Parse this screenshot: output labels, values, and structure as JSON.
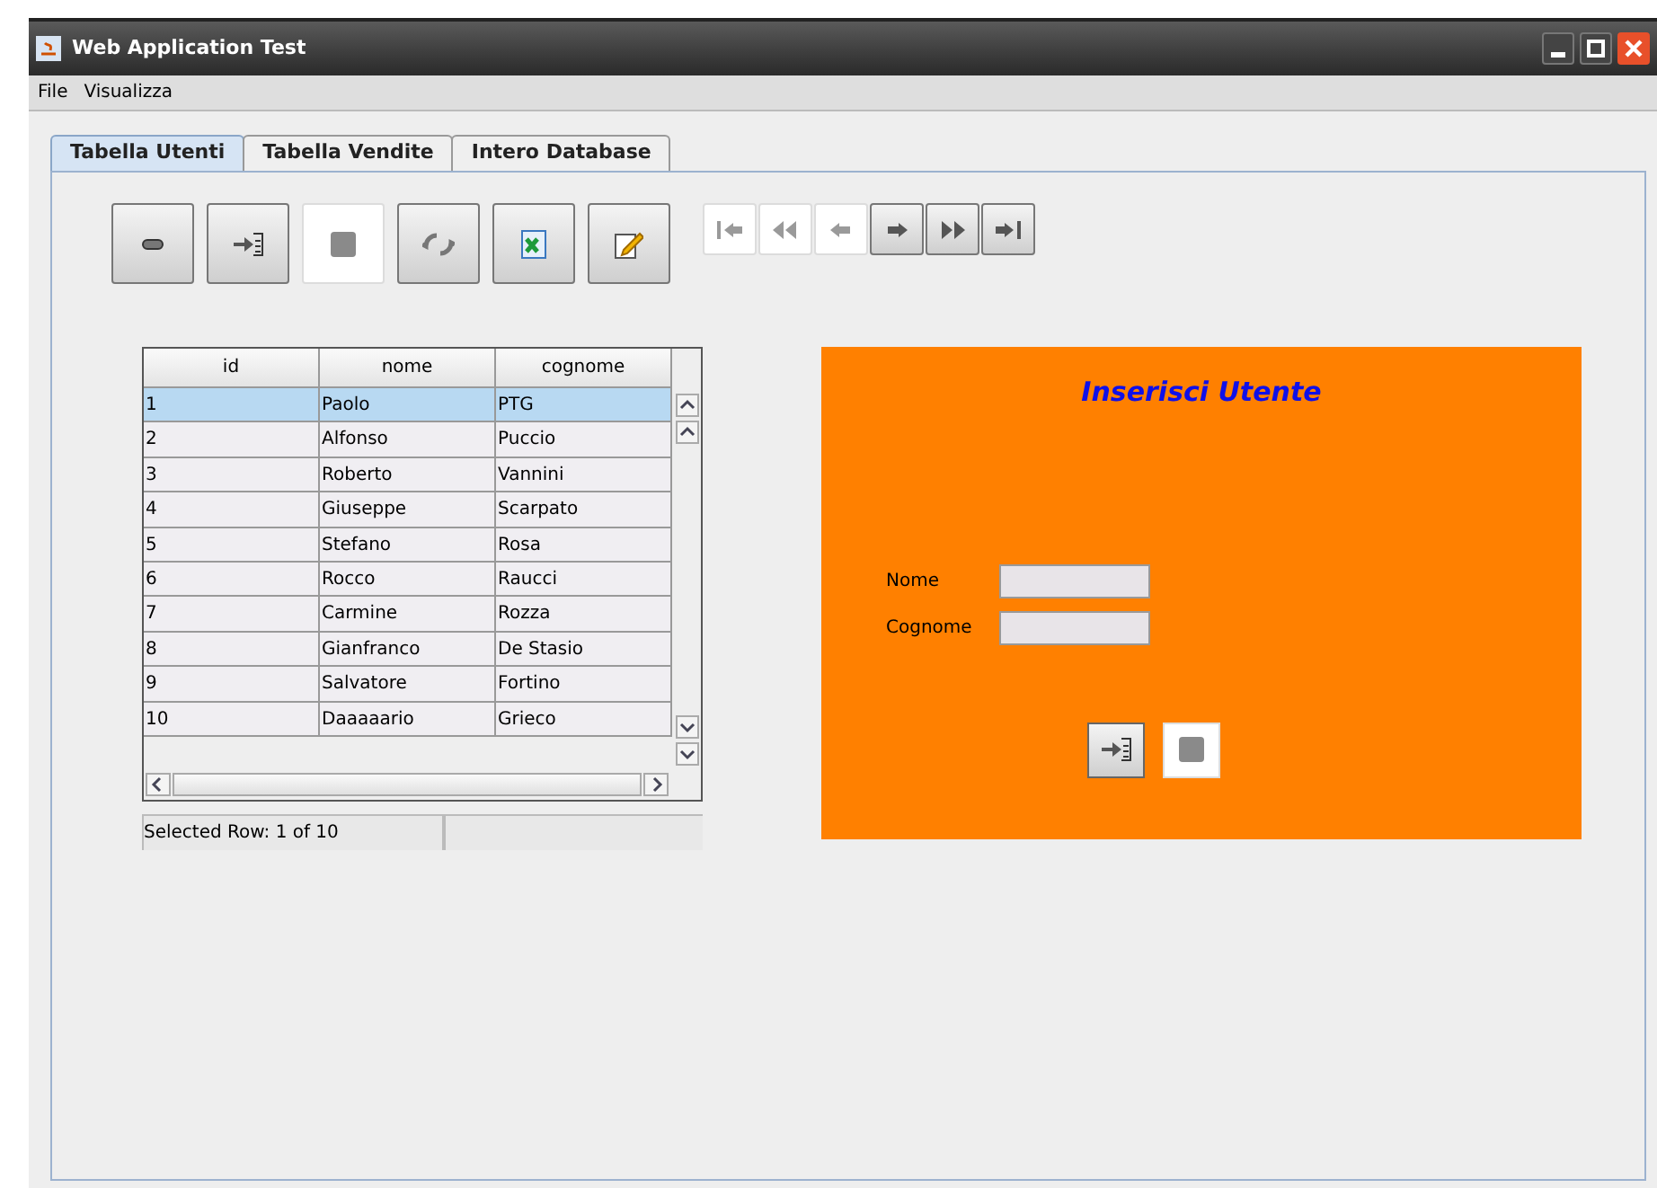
{
  "window": {
    "title": "Web Application Test"
  },
  "menu": [
    "File",
    "Visualizza"
  ],
  "tabs": [
    {
      "label": "Tabella Utenti",
      "selected": true
    },
    {
      "label": "Tabella Vendite",
      "selected": false
    },
    {
      "label": "Intero Database",
      "selected": false
    }
  ],
  "toolbar": [
    {
      "kind": "remove",
      "disabled": false
    },
    {
      "kind": "import",
      "disabled": false
    },
    {
      "kind": "save",
      "disabled": true
    },
    {
      "kind": "refresh",
      "disabled": false
    },
    {
      "kind": "spreadsheet",
      "disabled": false
    },
    {
      "kind": "edit",
      "disabled": false
    }
  ],
  "navigation": [
    {
      "kind": "first",
      "disabled": true
    },
    {
      "kind": "rewind",
      "disabled": true
    },
    {
      "kind": "previous",
      "disabled": true
    },
    {
      "kind": "next",
      "disabled": false
    },
    {
      "kind": "forward",
      "disabled": false
    },
    {
      "kind": "last",
      "disabled": false
    }
  ],
  "table": {
    "columns": [
      "id",
      "nome",
      "cognome"
    ],
    "rows": [
      {
        "cells": [
          "1",
          "Paolo",
          "PTG"
        ],
        "selected": true
      },
      {
        "cells": [
          "2",
          "Alfonso",
          "Puccio"
        ],
        "selected": false
      },
      {
        "cells": [
          "3",
          "Roberto",
          "Vannini"
        ],
        "selected": false
      },
      {
        "cells": [
          "4",
          "Giuseppe",
          "Scarpato"
        ],
        "selected": false
      },
      {
        "cells": [
          "5",
          "Stefano",
          "Rosa"
        ],
        "selected": false
      },
      {
        "cells": [
          "6",
          "Rocco",
          "Raucci"
        ],
        "selected": false
      },
      {
        "cells": [
          "7",
          "Carmine",
          "Rozza"
        ],
        "selected": false
      },
      {
        "cells": [
          "8",
          "Gianfranco",
          "De Stasio"
        ],
        "selected": false
      },
      {
        "cells": [
          "9",
          "Salvatore",
          "Fortino"
        ],
        "selected": false
      },
      {
        "cells": [
          "10",
          "Daaaaario",
          "Grieco"
        ],
        "selected": false
      }
    ],
    "status": "Selected Row: 1 of 10"
  },
  "form": {
    "title": "Inserisci Utente",
    "fields": [
      {
        "label": "Nome"
      },
      {
        "label": "Cognome"
      }
    ],
    "buttons": [
      {
        "kind": "import",
        "disabled": false
      },
      {
        "kind": "save",
        "disabled": true
      }
    ]
  }
}
